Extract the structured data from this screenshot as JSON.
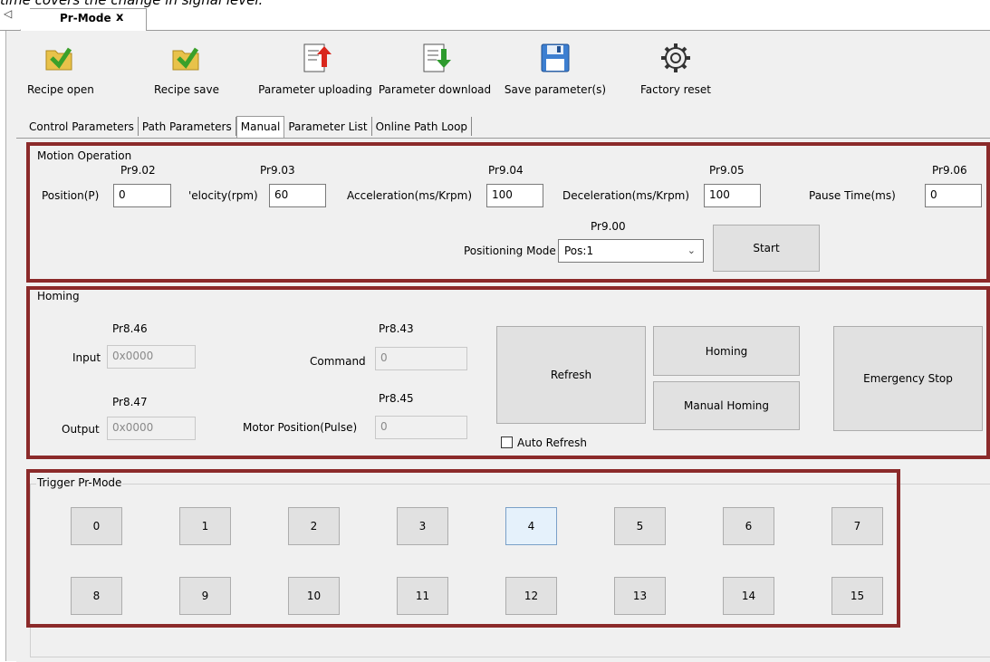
{
  "caption": "time covers the change in signal level.",
  "document_tab": {
    "title": "Pr-Mode",
    "close": "x",
    "nav_arrow": "◁"
  },
  "toolbar": [
    {
      "label": "Recipe open",
      "icon": "folder-open-icon"
    },
    {
      "label": "Recipe save",
      "icon": "folder-save-icon"
    },
    {
      "label": "Parameter uploading",
      "icon": "document-upload-icon"
    },
    {
      "label": "Parameter download",
      "icon": "document-download-icon"
    },
    {
      "label": "Save parameter(s)",
      "icon": "floppy-disk-icon"
    },
    {
      "label": "Factory reset",
      "icon": "gear-reset-icon"
    }
  ],
  "subtabs": [
    "Control Parameters",
    "Path Parameters",
    "Manual",
    "Parameter List",
    "Online Path Loop"
  ],
  "active_subtab": "Manual",
  "motion": {
    "legend": "Motion Operation",
    "position": {
      "param": "Pr9.02",
      "label": "Position(P)",
      "value": "0"
    },
    "velocity": {
      "param": "Pr9.03",
      "label": "'elocity(rpm)",
      "value": "60"
    },
    "acceleration": {
      "param": "Pr9.04",
      "label": "Acceleration(ms/Krpm)",
      "value": "100"
    },
    "deceleration": {
      "param": "Pr9.05",
      "label": "Deceleration(ms/Krpm)",
      "value": "100"
    },
    "pause": {
      "param": "Pr9.06",
      "label": "Pause Time(ms)",
      "value": "0"
    },
    "mode": {
      "param": "Pr9.00",
      "label": "Positioning Mode",
      "value": "Pos:1"
    },
    "start": "Start"
  },
  "homing": {
    "legend": "Homing",
    "input": {
      "param": "Pr8.46",
      "label": "Input",
      "value": "0x0000"
    },
    "output": {
      "param": "Pr8.47",
      "label": "Output",
      "value": "0x0000"
    },
    "command": {
      "param": "Pr8.43",
      "label": "Command",
      "value": "0"
    },
    "motor_position": {
      "param": "Pr8.45",
      "label": "Motor Position(Pulse)",
      "value": "0"
    },
    "refresh": "Refresh",
    "homing_btn": "Homing",
    "manual_homing": "Manual Homing",
    "emergency_stop": "Emergency Stop",
    "auto_refresh": "Auto Refresh"
  },
  "trigger": {
    "legend": "Trigger Pr-Mode",
    "buttons": [
      "0",
      "1",
      "2",
      "3",
      "4",
      "5",
      "6",
      "7",
      "8",
      "9",
      "10",
      "11",
      "12",
      "13",
      "14",
      "15"
    ]
  },
  "colors": {
    "highlight_border": "#8b2a2a",
    "panel_bg": "#f0f0f0"
  }
}
